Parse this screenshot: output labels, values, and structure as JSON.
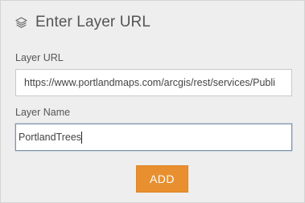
{
  "header": {
    "icon": "layers-icon",
    "title": "Enter Layer URL"
  },
  "form": {
    "layer_url": {
      "label": "Layer URL",
      "value": "https://www.portlandmaps.com/arcgis/rest/services/Publi‌"
    },
    "layer_name": {
      "label": "Layer Name",
      "value": "PortlandTrees"
    }
  },
  "actions": {
    "add_label": "ADD"
  },
  "colors": {
    "accent": "#e8902f",
    "background": "#eeeeee"
  }
}
